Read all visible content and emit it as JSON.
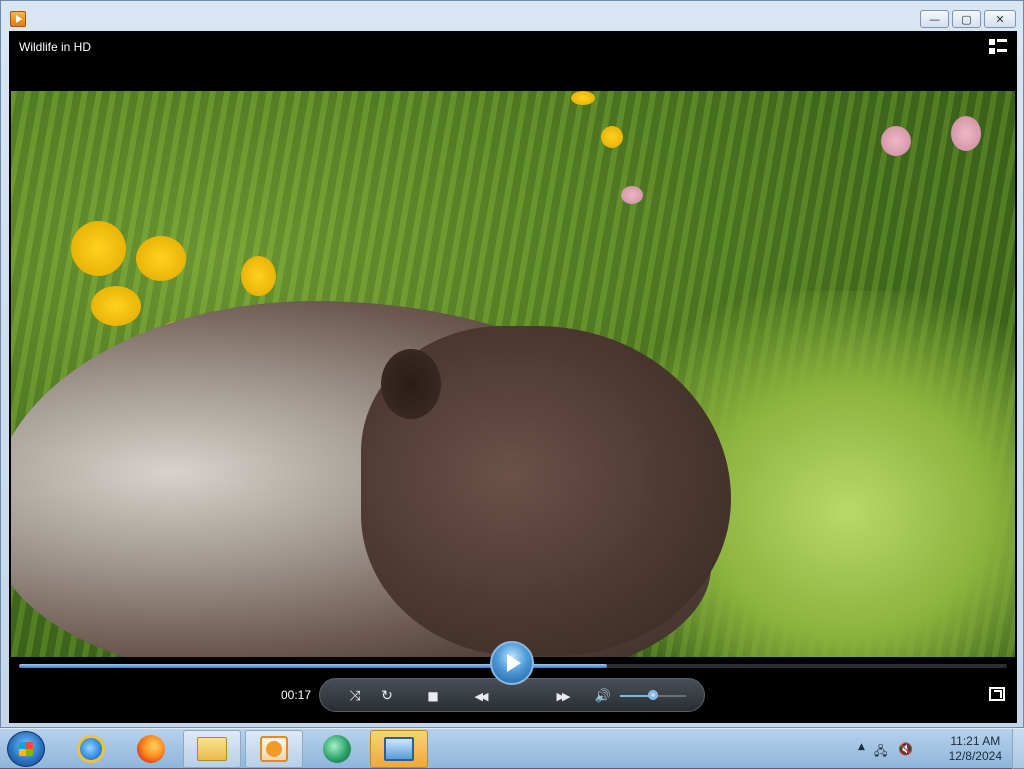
{
  "window": {
    "title": "",
    "controls": {
      "minimize": "—",
      "maximize": "▢",
      "close": "✕"
    }
  },
  "player": {
    "video_title": "Wildlife in HD",
    "elapsed_time": "00:17",
    "progress_fraction": 0.595,
    "volume_fraction": 0.5,
    "buttons": {
      "shuffle": "⤨",
      "repeat": "↻",
      "stop": "■",
      "previous": "◀◀",
      "play": "",
      "next": "▶▶",
      "mute": "🔊"
    }
  },
  "taskbar": {
    "items": [
      "Internet Explorer",
      "Firefox",
      "Windows Explorer",
      "Windows Media Player",
      "Media Center",
      "Remote Desktop"
    ],
    "tray": {
      "chevron": "▲",
      "network": "🖧",
      "volume": "🔇"
    },
    "clock": {
      "time": "11:21 AM",
      "date": "12/8/2024"
    }
  }
}
